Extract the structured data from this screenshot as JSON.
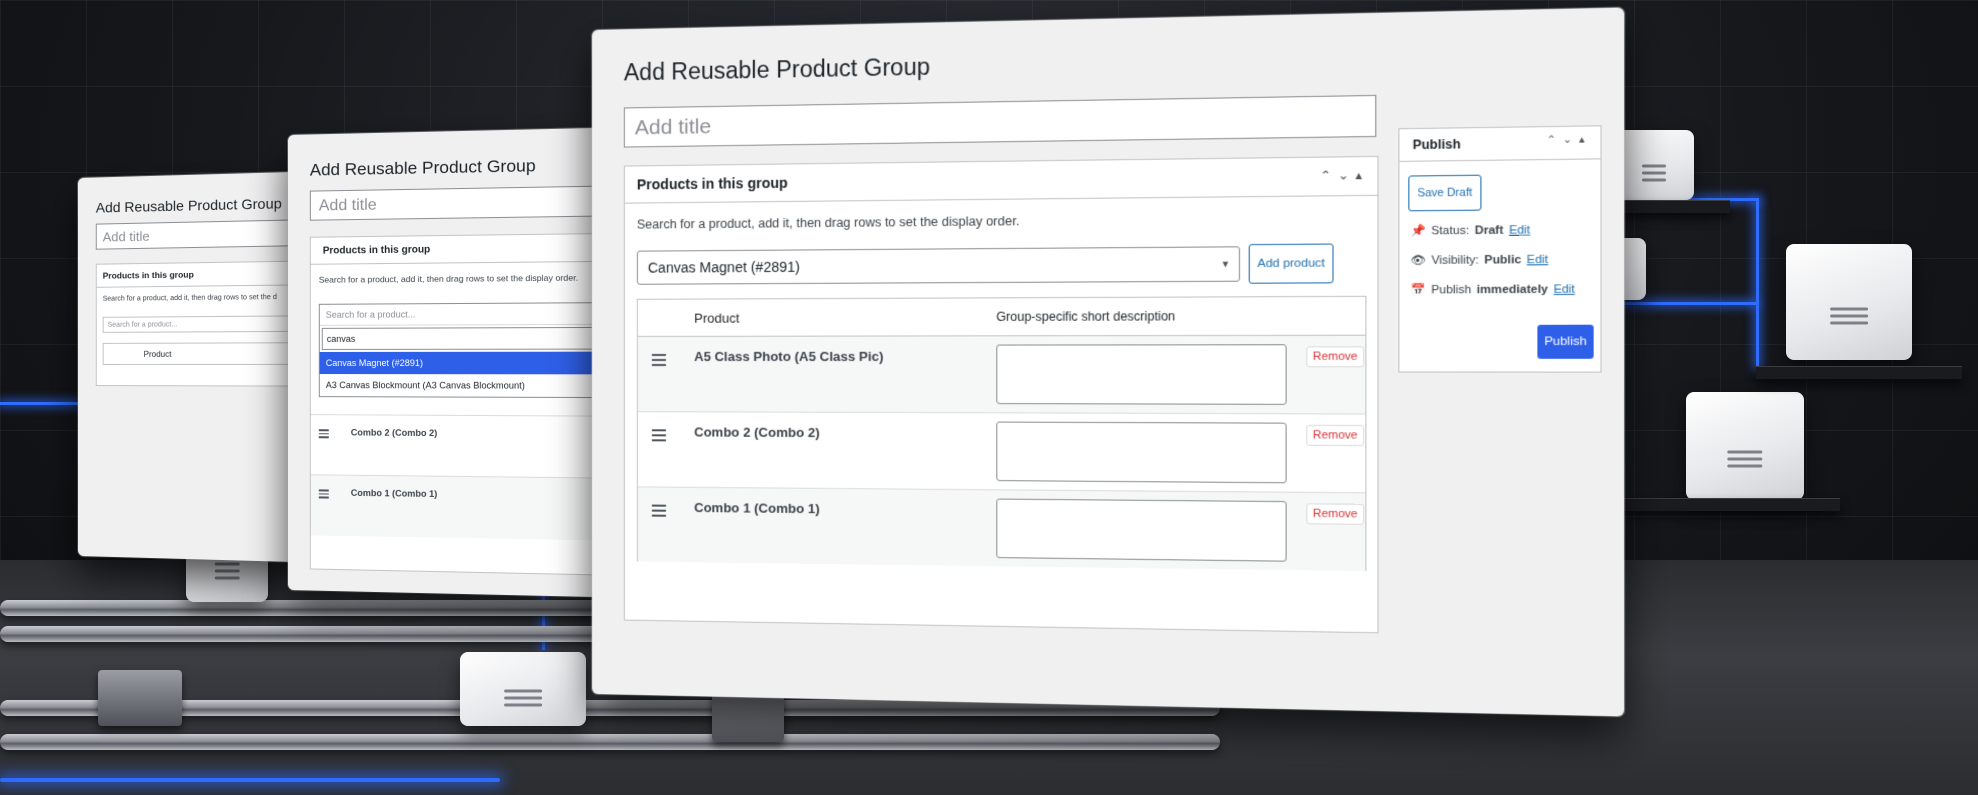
{
  "back_screen": {
    "page_title": "Add Reusable Product Group",
    "title_placeholder": "Add title",
    "box_title": "Products in this group",
    "description": "Search for a product, add it, then drag rows to set the d",
    "search_placeholder": "Search for a product...",
    "column_product": "Product"
  },
  "mid_screen": {
    "page_title": "Add Reusable Product Group",
    "title_placeholder": "Add title",
    "box_title": "Products in this group",
    "description": "Search for a product, add it, then drag rows to set the display order.",
    "search_placeholder": "Search for a product...",
    "search_query": "canvas",
    "options": [
      "Canvas Magnet (#2891)",
      "A3 Canvas Blockmount (A3 Canvas Blockmount)"
    ],
    "rows": [
      "Combo 2 (Combo 2)",
      "Combo 1 (Combo 1)"
    ]
  },
  "main_screen": {
    "page_title": "Add Reusable Product Group",
    "title_placeholder": "Add title",
    "products_box": {
      "title": "Products in this group",
      "description": "Search for a product, add it, then drag rows to set the display order.",
      "selected_product": "Canvas Magnet (#2891)",
      "add_button": "Add product",
      "columns": [
        "Product",
        "Group-specific short description"
      ],
      "rows": [
        {
          "name": "A5 Class Photo (A5 Class Pic)",
          "remove": "Remove"
        },
        {
          "name": "Combo 2 (Combo 2)",
          "remove": "Remove"
        },
        {
          "name": "Combo 1 (Combo 1)",
          "remove": "Remove"
        }
      ]
    },
    "publish_box": {
      "title": "Publish",
      "save_draft": "Save Draft",
      "status_label": "Status:",
      "status_value": "Draft",
      "visibility_label": "Visibility:",
      "visibility_value": "Public",
      "publish_label": "Publish",
      "publish_value": "immediately",
      "edit_link": "Edit",
      "publish_button": "Publish"
    }
  },
  "colors": {
    "accent": "#2e5fe8",
    "link": "#2271b1",
    "danger": "#d63638",
    "neon": "#2f6dff"
  }
}
